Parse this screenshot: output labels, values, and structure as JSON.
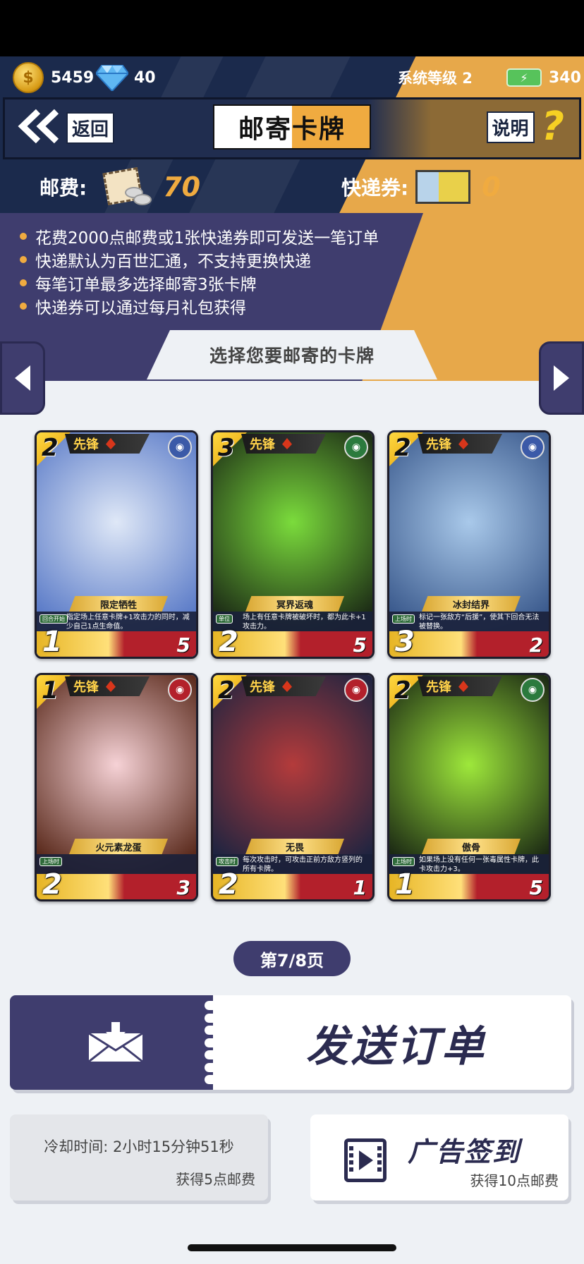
{
  "currency": {
    "coins": "5459",
    "gems": "40",
    "system_level": "系统等级 2",
    "energy": "340"
  },
  "nav": {
    "back_label": "返回",
    "title": "邮寄卡牌",
    "help_label": "说明",
    "help_mark": "?"
  },
  "fees": {
    "postage_label": "邮费:",
    "postage_value": "70",
    "express_label": "快递券:",
    "express_value": "0"
  },
  "rules": [
    "花费2000点邮费或1张快递券即可发送一笔订单",
    "快递默认为百世汇通，不支持更换快递",
    "每笔订单最多选择邮寄3张卡牌",
    "快递券可以通过每月礼包获得"
  ],
  "section_title": "选择您要邮寄的卡牌",
  "cards": [
    {
      "cost": "2",
      "role": "先锋",
      "name": "限定牺牲",
      "tag": "回合开始",
      "desc": "指定场上任意卡牌+1攻击力的同时，减少自己1点生命值。",
      "atk": "1",
      "hp": "5",
      "faction_color": "#3b5aa8",
      "art_a": "#dfe8f7",
      "art_b": "#5c7cc8"
    },
    {
      "cost": "3",
      "role": "先锋",
      "name": "冥界返魂",
      "tag": "单位",
      "desc": "场上有任意卡牌被破坏时，都为此卡+1攻击力。",
      "atk": "2",
      "hp": "5",
      "faction_color": "#2b7a3d",
      "art_a": "#7bdc3c",
      "art_b": "#1d2d16"
    },
    {
      "cost": "2",
      "role": "先锋",
      "name": "冰封结界",
      "tag": "上场时",
      "desc": "标记一张敌方“后援”，使其下回合无法被替换。",
      "atk": "3",
      "hp": "2",
      "faction_color": "#3b5aa8",
      "art_a": "#a9c9ea",
      "art_b": "#3c5b8e"
    },
    {
      "cost": "1",
      "role": "先锋",
      "name": "火元素龙蛋",
      "tag": "上场时",
      "desc": "",
      "atk": "2",
      "hp": "3",
      "faction_color": "#b3202b",
      "art_a": "#f6d2d6",
      "art_b": "#5b2b1d"
    },
    {
      "cost": "2",
      "role": "先锋",
      "name": "无畏",
      "tag": "攻击时",
      "desc": "每次攻击时，可攻击正前方敌方竖列的所有卡牌。",
      "atk": "2",
      "hp": "1",
      "faction_color": "#b3202b",
      "art_a": "#b43b3b",
      "art_b": "#1f2440"
    },
    {
      "cost": "2",
      "role": "先锋",
      "name": "傲骨",
      "tag": "上场时",
      "desc": "如果场上没有任何一张毒属性卡牌，此卡攻击力+3。",
      "atk": "1",
      "hp": "5",
      "faction_color": "#2b7a3d",
      "art_a": "#9ee83b",
      "art_b": "#1c2a14"
    }
  ],
  "pagination": "第7/8页",
  "send_order_label": "发送订单",
  "cooldown": {
    "label": "冷却时间: 2小时15分钟51秒",
    "reward": "获得5点邮费"
  },
  "ad_checkin": {
    "label": "广告签到",
    "reward": "获得10点邮费"
  }
}
